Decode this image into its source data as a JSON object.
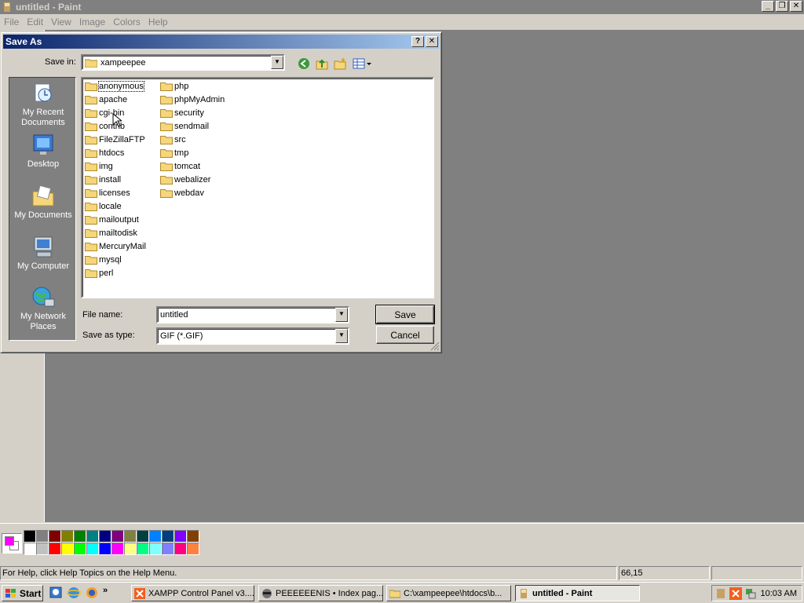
{
  "window": {
    "title": "untitled - Paint"
  },
  "menu": [
    "File",
    "Edit",
    "View",
    "Image",
    "Colors",
    "Help"
  ],
  "dialog": {
    "title": "Save As",
    "save_in_label": "Save in:",
    "save_in_value": "xampeepee",
    "places": [
      {
        "label": "My Recent Documents",
        "icon": "recent-documents-icon"
      },
      {
        "label": "Desktop",
        "icon": "desktop-icon"
      },
      {
        "label": "My Documents",
        "icon": "my-documents-icon"
      },
      {
        "label": "My Computer",
        "icon": "my-computer-icon"
      },
      {
        "label": "My Network Places",
        "icon": "network-places-icon"
      }
    ],
    "folders_col1": [
      "anonymous",
      "apache",
      "cgi-bin",
      "contrib",
      "FileZillaFTP",
      "htdocs",
      "img",
      "install",
      "licenses",
      "locale",
      "mailoutput",
      "mailtodisk",
      "MercuryMail",
      "mysql",
      "perl"
    ],
    "folders_col2": [
      "php",
      "phpMyAdmin",
      "security",
      "sendmail",
      "src",
      "tmp",
      "tomcat",
      "webalizer",
      "webdav"
    ],
    "file_name_label": "File name:",
    "file_name_value": "untitled",
    "save_type_label": "Save as type:",
    "save_type_value": "GIF (*.GIF)",
    "save_button": "Save",
    "cancel_button": "Cancel"
  },
  "palette": {
    "foreground": "#ff00ff",
    "background": "#ffffff",
    "row1": [
      "#000000",
      "#808080",
      "#800000",
      "#808000",
      "#008000",
      "#008080",
      "#000080",
      "#800080",
      "#808040",
      "#004040",
      "#0080ff",
      "#004080",
      "#8000ff",
      "#804000"
    ],
    "row2": [
      "#ffffff",
      "#c0c0c0",
      "#ff0000",
      "#ffff00",
      "#00ff00",
      "#00ffff",
      "#0000ff",
      "#ff00ff",
      "#ffff80",
      "#00ff80",
      "#80ffff",
      "#8080ff",
      "#ff0080",
      "#ff8040"
    ]
  },
  "status": {
    "help": "For Help, click Help Topics on the Help Menu.",
    "coords": "66,15"
  },
  "taskbar": {
    "start": "Start",
    "tasks": [
      "XAMPP Control Panel v3....",
      "PEEEEEENIS • Index pag...",
      "C:\\xampeepee\\htdocs\\b...",
      "untitled - Paint"
    ],
    "clock": "10:03 AM"
  }
}
